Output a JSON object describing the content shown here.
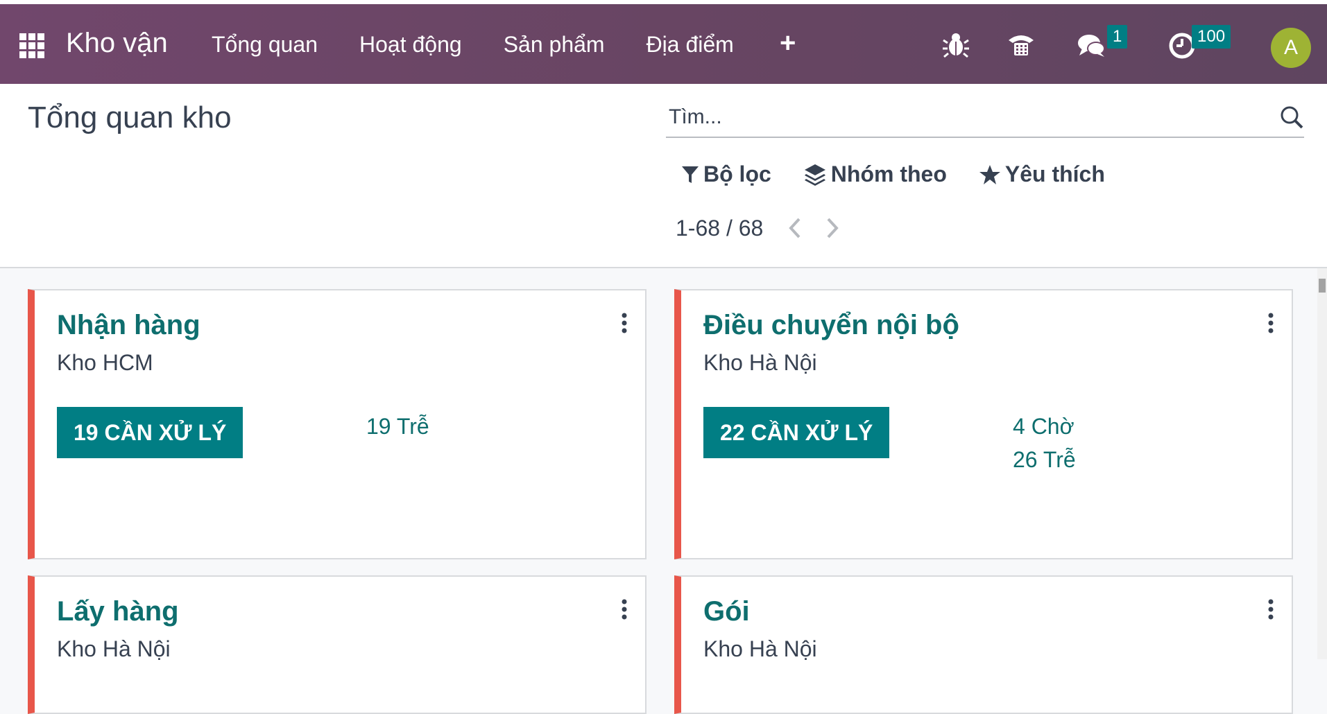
{
  "navbar": {
    "app_name": "Kho vận",
    "menu": [
      "Tổng quan",
      "Hoạt động",
      "Sản phẩm",
      "Địa điểm"
    ],
    "plus_label": "+",
    "messages_badge": "1",
    "activities_badge": "100",
    "avatar_initial": "A",
    "avatar_color": "#9eb334",
    "bg_color": "#6e4768"
  },
  "control": {
    "page_title": "Tổng quan kho",
    "search_placeholder": "Tìm...",
    "filter_label": "Bộ lọc",
    "groupby_label": "Nhóm theo",
    "favorites_label": "Yêu thích",
    "pager_value": "1-68 / 68"
  },
  "cards": [
    {
      "title": "Nhận hàng",
      "warehouse": "Kho HCM",
      "todo": "19 CẦN XỬ LÝ",
      "stats": [
        "19 Trễ"
      ]
    },
    {
      "title": "Điều chuyển nội bộ",
      "warehouse": "Kho Hà Nội",
      "todo": "22 CẦN XỬ LÝ",
      "stats": [
        "4 Chờ",
        "26 Trễ"
      ]
    },
    {
      "title": "Lấy hàng",
      "warehouse": "Kho Hà Nội"
    },
    {
      "title": "Gói",
      "warehouse": "Kho Hà Nội"
    }
  ],
  "colors": {
    "accent": "#017e84",
    "title": "#0e6e6e",
    "card_border_late": "#e8564a"
  }
}
